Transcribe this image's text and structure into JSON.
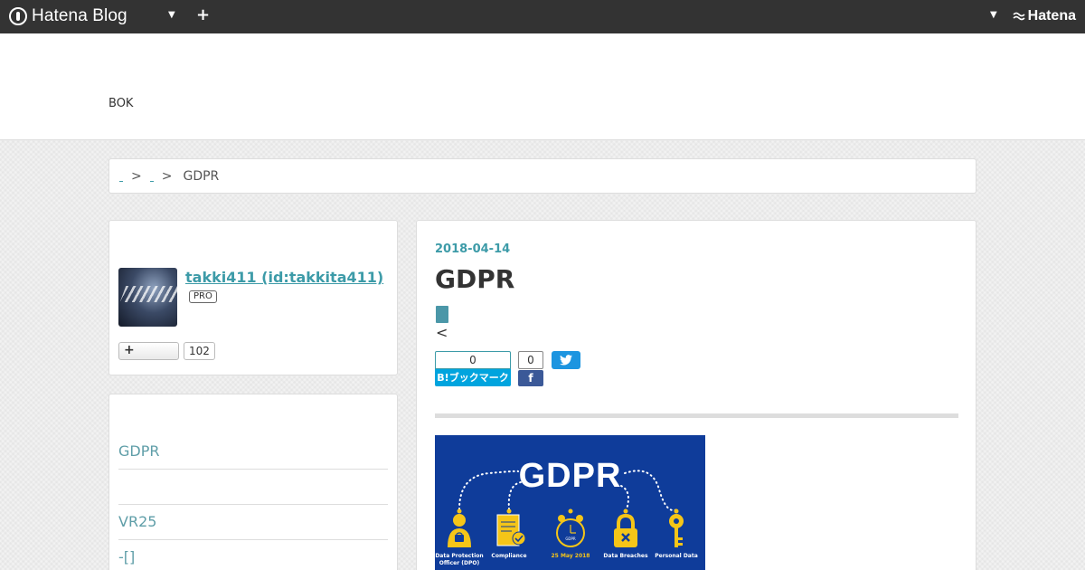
{
  "topbar": {
    "brand": "Hatena Blog",
    "hatena": "Hatena"
  },
  "blog": {
    "title": "BOK"
  },
  "breadcrumb": {
    "separator": ">",
    "current": "GDPR"
  },
  "profile": {
    "name": "takki411 (id:takkita411)",
    "badge": "PRO",
    "follow_label": "+",
    "followers": "102"
  },
  "sidebar": {
    "items": [
      {
        "label": "GDPR"
      },
      {
        "label": ""
      },
      {
        "label": "VR25"
      },
      {
        "label": "-[]"
      }
    ]
  },
  "entry": {
    "date": "2018-04-14",
    "title": "GDPR",
    "lt": "<",
    "hatebu_count": "0",
    "hatebu_label": "B!ブックマーク",
    "fb_count": "0",
    "fb_icon": "f"
  },
  "figure": {
    "heading": "GDPR",
    "labels": [
      "Data Protection Officer (DPO)",
      "Compliance",
      "25 May 2018",
      "Data Breaches",
      "Personal Data"
    ],
    "clock_label": "GDPR",
    "colors": {
      "background": "#0f3c9a",
      "accent": "#f5c518"
    }
  },
  "colors": {
    "topbar": "#333333",
    "link": "#3d9ba8",
    "hatebu": "#00a4de",
    "facebook": "#3b5998",
    "twitter": "#1d95e0"
  }
}
